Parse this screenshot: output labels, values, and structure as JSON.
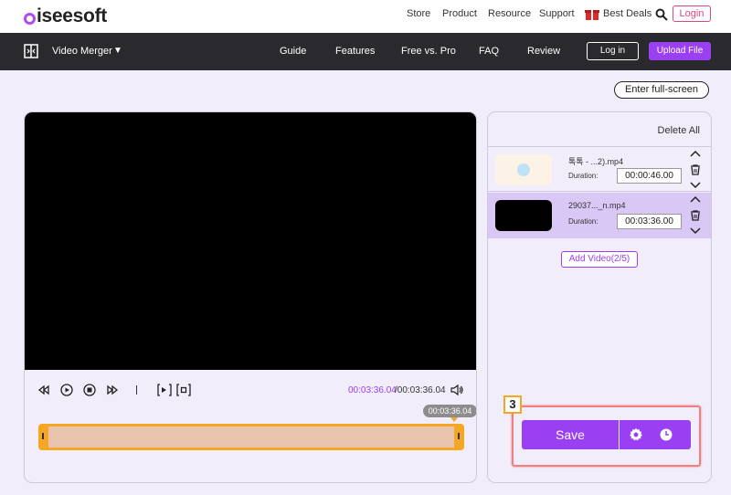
{
  "header": {
    "logo_text": "iseesoft",
    "nav": [
      "Store",
      "Product",
      "Resource",
      "Support"
    ],
    "best_deals": "Best Deals",
    "login": "Login"
  },
  "navbar": {
    "tool_name": "Video Merger",
    "links": [
      "Guide",
      "Features",
      "Free vs. Pro",
      "FAQ",
      "Review"
    ],
    "login": "Log in",
    "upload": "Upload File"
  },
  "fullscreen_label": "Enter full-screen",
  "player": {
    "current_time": "00:03:36.04",
    "total_time": "/00:03:36.04",
    "tooltip_time": "00:03:36.04"
  },
  "list": {
    "delete_all": "Delete All",
    "clips": [
      {
        "name": "톡톡 - ...2).mp4",
        "duration_label": "Duration:",
        "duration": "00:00:46.00",
        "selected": false
      },
      {
        "name": "29037..._n.mp4",
        "duration_label": "Duration:",
        "duration": "00:03:36.00",
        "selected": true
      }
    ],
    "add_video": "Add Video(2/5)"
  },
  "save": {
    "step": "3",
    "label": "Save"
  },
  "colors": {
    "accent": "#9b3ff2",
    "highlight": "#f08080",
    "trim": "#f5a623"
  }
}
